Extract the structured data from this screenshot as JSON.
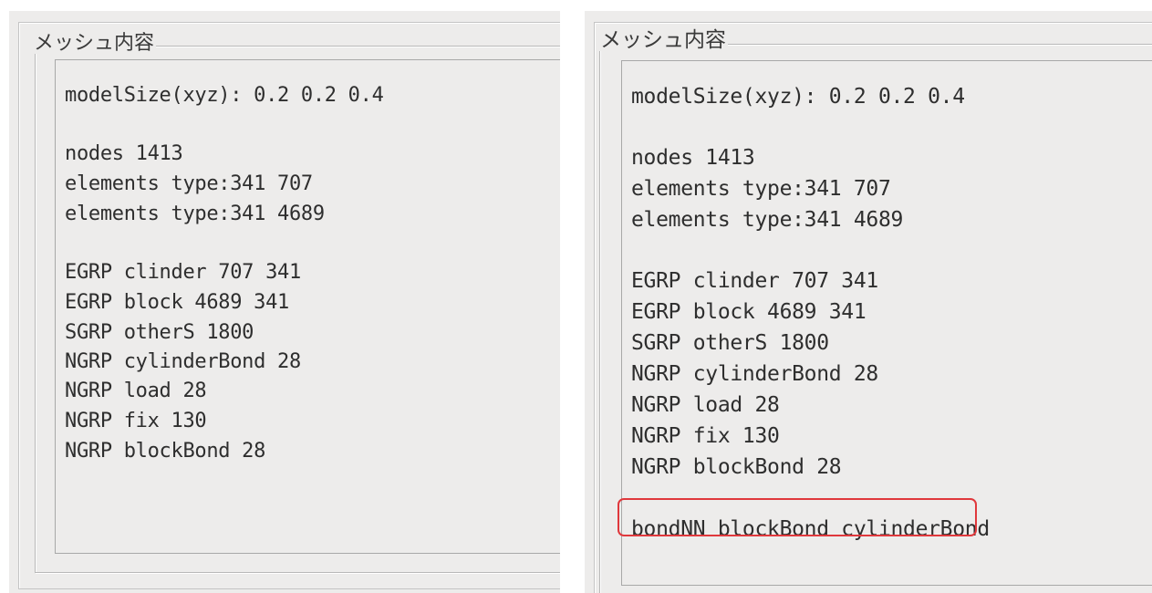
{
  "left_panel": {
    "group_title": "メッシュ内容",
    "lines": [
      "modelSize(xyz): 0.2 0.2 0.4",
      "nodes 1413",
      "elements type:341 707",
      "elements type:341 4689",
      "EGRP clinder 707 341",
      "EGRP block 4689 341",
      "SGRP otherS 1800",
      "NGRP cylinderBond 28",
      "NGRP load 28",
      "NGRP fix 130",
      "NGRP blockBond 28"
    ]
  },
  "right_panel": {
    "group_title": "メッシュ内容",
    "lines": [
      "modelSize(xyz): 0.2 0.2 0.4",
      "nodes 1413",
      "elements type:341 707",
      "elements type:341 4689",
      "EGRP clinder 707 341",
      "EGRP block 4689 341",
      "SGRP otherS 1800",
      "NGRP cylinderBond 28",
      "NGRP load 28",
      "NGRP fix 130",
      "NGRP blockBond 28",
      "bondNN blockBond cylinderBond"
    ],
    "highlighted_line": "bondNN blockBond cylinderBond"
  },
  "colors": {
    "panel_background": "#edeceb",
    "highlight_border": "#e0383c"
  }
}
